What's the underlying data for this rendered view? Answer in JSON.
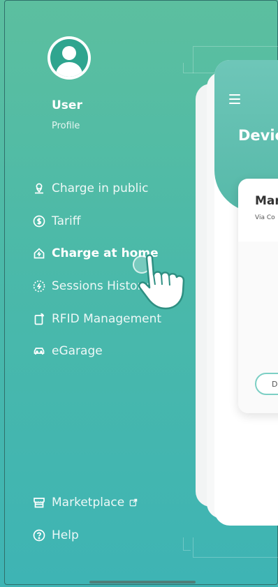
{
  "user": {
    "name": "User",
    "subtitle": "Profile"
  },
  "menu": {
    "items": [
      {
        "label": "Charge in public",
        "icon": "location-person-icon",
        "active": false
      },
      {
        "label": "Tariff",
        "icon": "dollar-circle-icon",
        "active": false
      },
      {
        "label": "Charge at home",
        "icon": "home-bolt-icon",
        "active": true
      },
      {
        "label": "Sessions History",
        "icon": "dotted-bolt-circle-icon",
        "active": false
      },
      {
        "label": "RFID Management",
        "icon": "rfid-card-icon",
        "active": false
      },
      {
        "label": "eGarage",
        "icon": "car-icon",
        "active": false
      }
    ],
    "bottom": [
      {
        "label": "Marketplace",
        "icon": "store-icon",
        "external_icon": "external-link-icon"
      },
      {
        "label": "Help",
        "icon": "help-circle-icon"
      }
    ]
  },
  "preview": {
    "title": "Devic",
    "tile_title": "Mar",
    "tile_sub": "Via Co",
    "tile_button": "D"
  },
  "colors": {
    "accent": "#4bb9a9",
    "gradient_top": "#5cbf9f",
    "gradient_bottom": "#3eb4b4"
  }
}
